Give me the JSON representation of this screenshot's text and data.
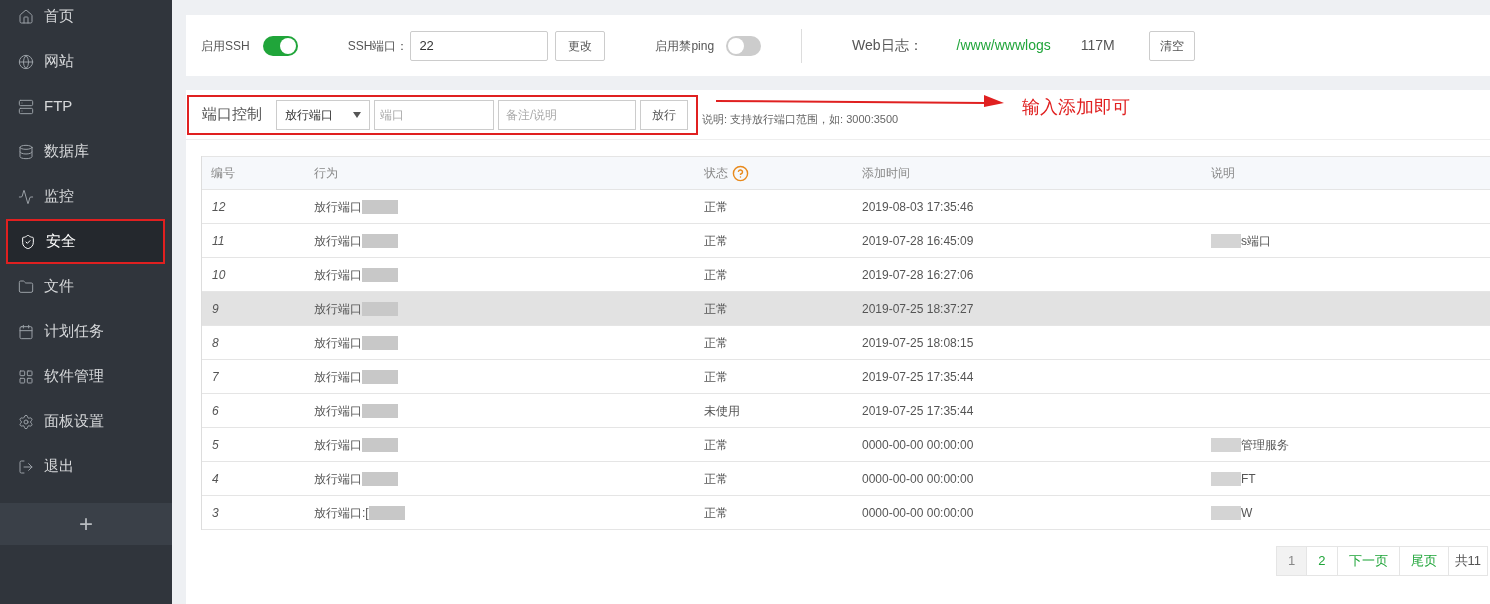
{
  "sidebar": {
    "items": [
      {
        "label": "首页",
        "selected": false
      },
      {
        "label": "网站",
        "selected": false
      },
      {
        "label": "FTP",
        "selected": false
      },
      {
        "label": "数据库",
        "selected": false
      },
      {
        "label": "监控",
        "selected": false
      },
      {
        "label": "安全",
        "selected": true
      },
      {
        "label": "文件",
        "selected": false
      },
      {
        "label": "计划任务",
        "selected": false
      },
      {
        "label": "软件管理",
        "selected": false
      },
      {
        "label": "面板设置",
        "selected": false
      },
      {
        "label": "退出",
        "selected": false
      }
    ],
    "add_button": "+"
  },
  "settings": {
    "ssh_label": "启用SSH",
    "ssh_on": true,
    "port_label": "SSH端口：",
    "port_value": "22",
    "change_button": "更改",
    "ping_label": "启用禁ping",
    "ping_on": false,
    "log_label": "Web日志：",
    "log_path": "/www/wwwlogs",
    "log_size": "117M",
    "clear_button": "清空"
  },
  "port_control": {
    "title": "端口控制",
    "select_value": "放行端口",
    "port_placeholder": "端口",
    "note_placeholder": "备注/说明",
    "submit_button": "放行",
    "hint": "说明: 支持放行端口范围，如: 3000:3500"
  },
  "annotation": {
    "text": "输入添加即可"
  },
  "table": {
    "columns": [
      "编号",
      "行为",
      "状态",
      "添加时间",
      "说明"
    ],
    "rows": [
      {
        "id": "12",
        "action": "放行端口",
        "status": "正常",
        "time": "2019-08-03 17:35:46",
        "hovered": false
      },
      {
        "id": "11",
        "action": "放行端口",
        "status": "正常",
        "time": "2019-07-28 16:45:09",
        "note": "s端口",
        "hovered": false
      },
      {
        "id": "10",
        "action": "放行端口",
        "status": "正常",
        "time": "2019-07-28 16:27:06",
        "hovered": false
      },
      {
        "id": "9",
        "action": "放行端口",
        "status": "正常",
        "time": "2019-07-25 18:37:27",
        "hovered": true
      },
      {
        "id": "8",
        "action": "放行端口",
        "status": "正常",
        "time": "2019-07-25 18:08:15",
        "hovered": false
      },
      {
        "id": "7",
        "action": "放行端口",
        "status": "正常",
        "time": "2019-07-25 17:35:44",
        "hovered": false
      },
      {
        "id": "6",
        "action": "放行端口",
        "status": "未使用",
        "time": "2019-07-25 17:35:44",
        "hovered": false
      },
      {
        "id": "5",
        "action": "放行端口",
        "status": "正常",
        "time": "0000-00-00 00:00:00",
        "note": "管理服务",
        "hovered": false
      },
      {
        "id": "4",
        "action": "放行端口",
        "status": "正常",
        "time": "0000-00-00 00:00:00",
        "note": "FT",
        "hovered": false
      },
      {
        "id": "3",
        "action": "放行端口:[",
        "status": "正常",
        "time": "0000-00-00 00:00:00",
        "note": "W",
        "hovered": false
      }
    ]
  },
  "pagination": {
    "pages": [
      {
        "label": "1",
        "selected": true
      },
      {
        "label": "2",
        "selected": false
      },
      {
        "label": "下一页",
        "selected": false
      },
      {
        "label": "尾页",
        "selected": false
      }
    ],
    "total": "共11"
  }
}
